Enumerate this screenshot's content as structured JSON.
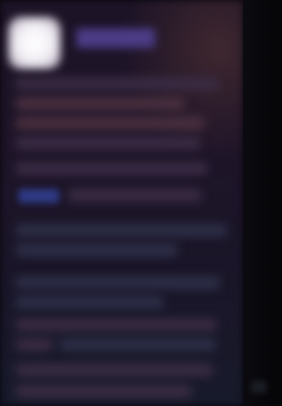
{
  "message": {
    "sender_name": "",
    "body_lines": [
      "",
      "",
      "",
      "",
      "",
      "",
      "",
      "",
      "",
      "",
      "",
      "",
      "",
      "",
      ""
    ],
    "link_text": ""
  },
  "colors": {
    "background": "#07060c",
    "panel": "#1e1428",
    "avatar": "#ffffff",
    "sender_accent": "#4b3c86",
    "link_accent": "#2f3a86"
  },
  "icons": {
    "avatar": "avatar-image",
    "corner": "scroll-indicator-icon"
  }
}
